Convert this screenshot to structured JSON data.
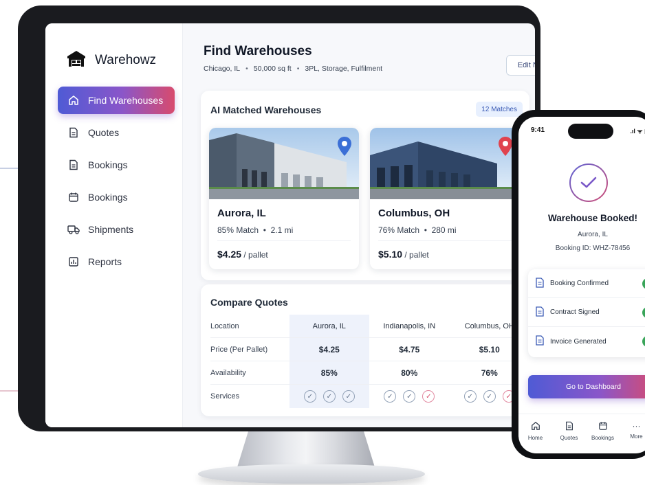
{
  "app": {
    "name": "Warehowz"
  },
  "sidebar": {
    "items": [
      {
        "label": "Find Warehouses",
        "icon": "home-icon",
        "active": true
      },
      {
        "label": "Quotes",
        "icon": "document-icon"
      },
      {
        "label": "Bookings",
        "icon": "document-icon"
      },
      {
        "label": "Bookings",
        "icon": "calendar-icon"
      },
      {
        "label": "Shipments",
        "icon": "truck-icon"
      },
      {
        "label": "Reports",
        "icon": "chart-icon"
      }
    ]
  },
  "header": {
    "title": "Find Warehouses",
    "location": "Chicago, IL",
    "size": "50,000 sq ft",
    "services": "3PL, Storage, Fulfilment",
    "edit_label": "Edit Need"
  },
  "matches": {
    "title": "AI Matched Warehouses",
    "badge": "12 Matches",
    "cards": [
      {
        "city": "Aurora, IL",
        "match": "85% Match",
        "distance": "2.1 mi",
        "price": "$4.25",
        "unit": "/ pallet",
        "pin_color": "#3b6fd6"
      },
      {
        "city": "Columbus, OH",
        "match": "76% Match",
        "distance": "280 mi",
        "price": "$5.10",
        "unit": "/ pallet",
        "pin_color": "#e0434e"
      }
    ]
  },
  "compare": {
    "title": "Compare Quotes",
    "rows": [
      {
        "label": "Location",
        "values": [
          "Aurora, IL",
          "Indianapolis, IN",
          "Columbus, OH"
        ]
      },
      {
        "label": "Price (Per Pallet)",
        "values": [
          "$4.25",
          "$4.75",
          "$5.10"
        ]
      },
      {
        "label": "Availability",
        "values": [
          "85%",
          "80%",
          "76%"
        ]
      },
      {
        "label": "Services",
        "values": []
      }
    ]
  },
  "phone": {
    "time": "9:41",
    "signal": ".ıl ᯤ ▮",
    "title": "Warehouse Booked!",
    "location": "Aurora, IL",
    "booking_id": "Booking ID: WHZ-78456",
    "steps": [
      "Booking Confirmed",
      "Contract Signed",
      "Invoice Generated"
    ],
    "cta": "Go to Dashboard",
    "tabs": [
      "Home",
      "Quotes",
      "Bookings",
      "More"
    ]
  },
  "colors": {
    "accent_start": "#4f5bd5",
    "accent_end": "#d84b6e",
    "success": "#3aa55a"
  }
}
